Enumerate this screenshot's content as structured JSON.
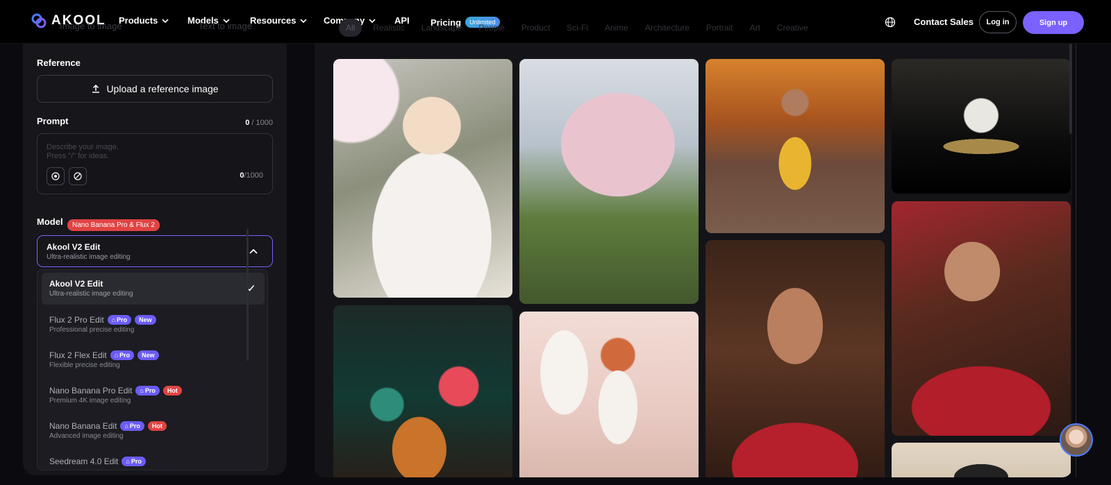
{
  "brand": {
    "name": "AKOOL"
  },
  "nav": {
    "products": "Products",
    "models": "Models",
    "resources": "Resources",
    "company": "Company",
    "api": "API",
    "pricing": "Pricing",
    "pricing_badge": "Unlimited",
    "contact": "Contact Sales",
    "login": "Log in",
    "signup": "Sign up"
  },
  "mode_tabs": [
    "Image to image",
    "Text to image"
  ],
  "filters": [
    "All",
    "Realistic",
    "Landscape",
    "People",
    "Product",
    "Sci-Fi",
    "Anime",
    "Architecture",
    "Portrait",
    "Art",
    "Creative"
  ],
  "panel": {
    "reference_label": "Reference",
    "upload_label": "Upload a reference image",
    "prompt_label": "Prompt",
    "prompt_count": "0",
    "prompt_max": " / 1000",
    "prompt_placeholder": "Describe your image.\nPress \"/\" for ideas.",
    "prompt_count_inner": "0",
    "prompt_max_inner": "/1000",
    "model_label": "Model",
    "model_badge": "Nano Banana Pro & Flux 2",
    "selected_model": {
      "name": "Akool V2 Edit",
      "desc": "Ultra-realistic image editing"
    }
  },
  "dropdown": [
    {
      "name": "Akool V2 Edit",
      "desc": "Ultra-realistic image editing",
      "tags": [],
      "selected": true
    },
    {
      "name": "Flux 2 Pro Edit",
      "desc": "Professional precise editing",
      "tags": [
        "Pro",
        "New"
      ]
    },
    {
      "name": "Flux 2 Flex Edit",
      "desc": "Flexible precise editing",
      "tags": [
        "Pro",
        "New"
      ]
    },
    {
      "name": "Nano Banana Pro Edit",
      "desc": "Premium 4K image editing",
      "tags": [
        "Pro",
        "Hot"
      ]
    },
    {
      "name": "Nano Banana Edit",
      "desc": "Advanced image editing",
      "tags": [
        "Pro",
        "Hot"
      ]
    },
    {
      "name": "Seedream 4.0 Edit",
      "desc": "",
      "tags": [
        "Pro"
      ]
    }
  ],
  "colors": {
    "accent": "#7b61ff",
    "hot": "#e04343",
    "bg": "#0b0b0f"
  }
}
